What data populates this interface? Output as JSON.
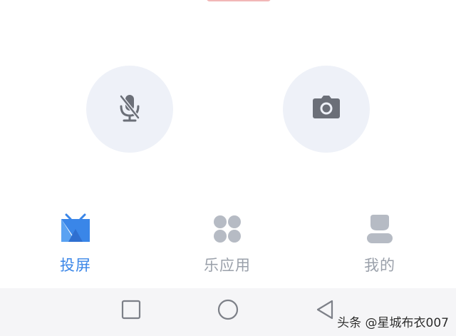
{
  "controls": {
    "mic_icon": "mic-off-icon",
    "camera_icon": "camera-icon"
  },
  "tabs": [
    {
      "label": "投屏",
      "icon": "screen-cast-icon",
      "active": true
    },
    {
      "label": "乐应用",
      "icon": "apps-grid-icon",
      "active": false
    },
    {
      "label": "我的",
      "icon": "profile-icon",
      "active": false
    }
  ],
  "system_nav": {
    "recent": "square-icon",
    "home": "circle-icon",
    "back": "triangle-back-icon"
  },
  "watermark": "头条 @星城布衣007",
  "colors": {
    "active": "#3a86e8",
    "inactive": "#9aa0aa",
    "icon_gray": "#6b6f78",
    "button_bg": "#eef1f8"
  }
}
